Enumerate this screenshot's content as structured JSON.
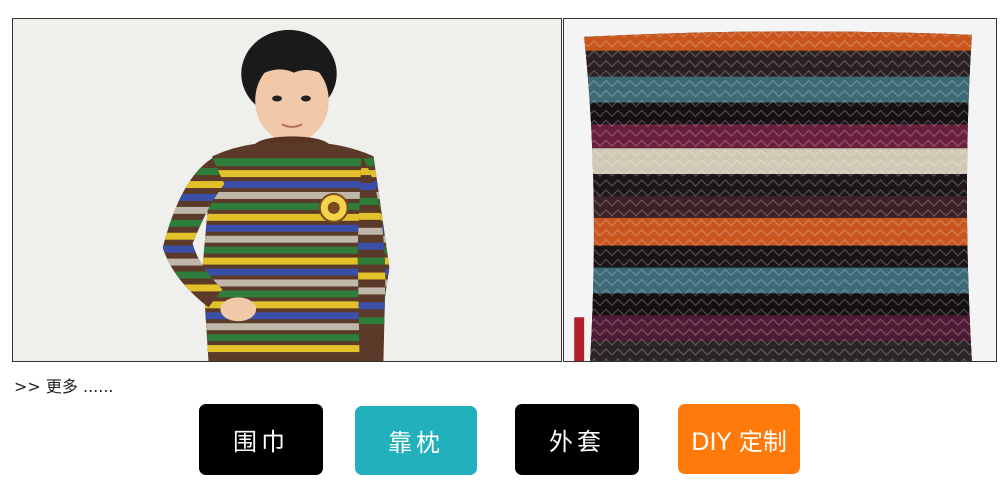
{
  "gallery": {
    "left_image_icon": "child-striped-sweater-photo",
    "right_image_icon": "zigzag-knit-cushion-photo"
  },
  "more": {
    "label": ">> 更多 ......"
  },
  "categories": [
    {
      "label": "围巾",
      "color": "#000000"
    },
    {
      "label": "靠枕",
      "color": "#22b0bd"
    },
    {
      "label": "外套",
      "color": "#000000"
    },
    {
      "label": "DIY 定制",
      "color": "#ff7a0a"
    }
  ]
}
